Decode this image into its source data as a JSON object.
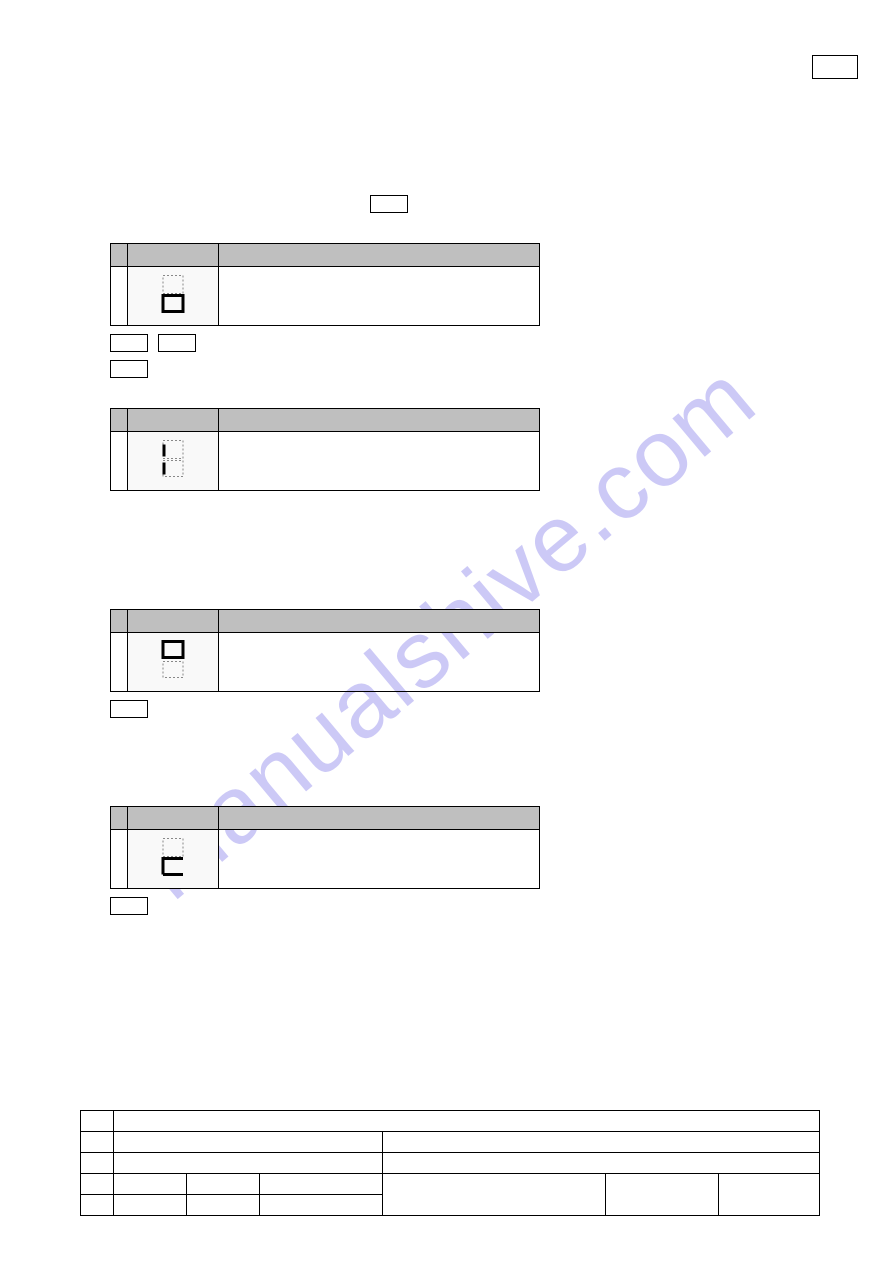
{
  "watermark": "manualshive.com",
  "params": [
    {
      "display_hint": "u-bottom",
      "label": "",
      "desc": "",
      "below_boxes": 2,
      "below_box_after": 1
    },
    {
      "display_hint": "left-bar",
      "label": "",
      "desc": "",
      "below_boxes": 0,
      "below_box_after": 0
    },
    {
      "display_hint": "o-top",
      "label": "",
      "desc": "",
      "below_boxes": 1,
      "below_box_after": 0
    },
    {
      "display_hint": "c-bottom",
      "label": "",
      "desc": "",
      "below_boxes": 1,
      "below_box_after": 0
    }
  ],
  "footer_cols_row4": 7,
  "footer_cols_row5": 6
}
